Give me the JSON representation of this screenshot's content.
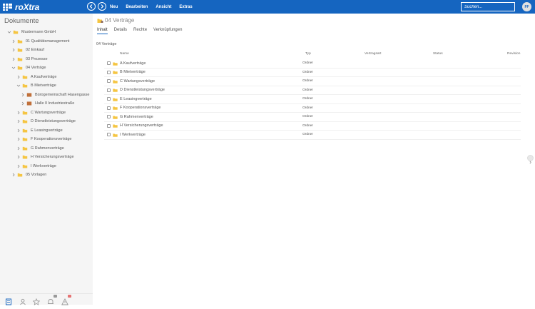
{
  "app": {
    "logo_text": "roXtra"
  },
  "menu": {
    "items": [
      "Neu",
      "Bearbeiten",
      "Ansicht",
      "Extras"
    ]
  },
  "search": {
    "placeholder": "Suchen..."
  },
  "user": {
    "initials": "FF"
  },
  "sidebar": {
    "title": "Dokumente",
    "tree": [
      {
        "label": "Mustermann GmbH",
        "level": 0,
        "expanded": true,
        "special": false
      },
      {
        "label": "01 Qualitätsmanagement",
        "level": 1,
        "expanded": false,
        "special": false
      },
      {
        "label": "02 Einkauf",
        "level": 1,
        "expanded": false,
        "special": false
      },
      {
        "label": "03 Prozesse",
        "level": 1,
        "expanded": false,
        "special": false
      },
      {
        "label": "04 Verträge",
        "level": 1,
        "expanded": true,
        "special": false
      },
      {
        "label": "A Kaufverträge",
        "level": 2,
        "expanded": false,
        "special": false
      },
      {
        "label": "B Mietverträge",
        "level": 2,
        "expanded": true,
        "special": false
      },
      {
        "label": "Bürogemeinschaft Hasengasse",
        "level": 3,
        "expanded": false,
        "special": true
      },
      {
        "label": "Halle II Industriestraße",
        "level": 3,
        "expanded": false,
        "special": true
      },
      {
        "label": "C Wartungsverträge",
        "level": 2,
        "expanded": false,
        "special": false
      },
      {
        "label": "D Dienstleistungsverträge",
        "level": 2,
        "expanded": false,
        "special": false
      },
      {
        "label": "E Leasingverträge",
        "level": 2,
        "expanded": false,
        "special": false
      },
      {
        "label": "F Kooperationsverträge",
        "level": 2,
        "expanded": false,
        "special": false
      },
      {
        "label": "G Rahmenverträge",
        "level": 2,
        "expanded": false,
        "special": false
      },
      {
        "label": "H Versicherungsverträge",
        "level": 2,
        "expanded": false,
        "special": false
      },
      {
        "label": "I Werkverträge",
        "level": 2,
        "expanded": false,
        "special": false
      },
      {
        "label": "05 Vorlagen",
        "level": 1,
        "expanded": false,
        "special": false
      }
    ],
    "bottom_icons": [
      "documents-icon",
      "user-icon",
      "star-icon",
      "bell-icon",
      "warning-icon"
    ]
  },
  "main": {
    "title": "04 Verträge",
    "tabs": [
      {
        "label": "Inhalt",
        "active": true
      },
      {
        "label": "Details",
        "active": false
      },
      {
        "label": "Rechte",
        "active": false
      },
      {
        "label": "Verknüpfungen",
        "active": false
      }
    ],
    "section_title": "04 Verträge",
    "columns": {
      "name": "Name",
      "type": "Typ",
      "contract_type": "Vertragsart",
      "status": "Status",
      "revision": "Revision"
    },
    "rows": [
      {
        "name": "A Kaufverträge",
        "type": "Ordner"
      },
      {
        "name": "B Mietverträge",
        "type": "Ordner"
      },
      {
        "name": "C Wartungsverträge",
        "type": "Ordner"
      },
      {
        "name": "D Dienstleistungsverträge",
        "type": "Ordner"
      },
      {
        "name": "E Leasingverträge",
        "type": "Ordner"
      },
      {
        "name": "F Kooperationsverträge",
        "type": "Ordner"
      },
      {
        "name": "G Rahmenverträge",
        "type": "Ordner"
      },
      {
        "name": "H Versicherungsverträge",
        "type": "Ordner"
      },
      {
        "name": "I Werkverträge",
        "type": "Ordner"
      }
    ]
  },
  "colors": {
    "brand": "#1565c0",
    "folder": "#f5c542",
    "folder_special": "#c0703a",
    "badge_red": "#e57373"
  }
}
